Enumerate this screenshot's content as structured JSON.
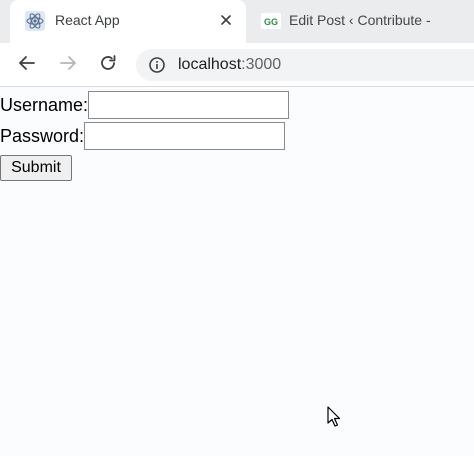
{
  "browser": {
    "tabs": [
      {
        "title": "React App",
        "favicon": "react-atom-icon",
        "active": true
      },
      {
        "title": "Edit Post ‹ Contribute -",
        "favicon": "gfg-logo-icon",
        "active": false
      }
    ],
    "url": {
      "host": "localhost",
      "port": ":3000"
    },
    "icons": {
      "back": "back-arrow-icon",
      "forward": "forward-arrow-icon",
      "reload": "reload-icon",
      "site_info": "info-icon",
      "close_tab": "close-icon"
    }
  },
  "form": {
    "username_label": "Username:",
    "username_value": "",
    "password_label": "Password:",
    "password_value": "",
    "submit_label": "Submit"
  },
  "colors": {
    "tabstrip_bg": "#ebecee",
    "active_tab_bg": "#ffffff",
    "page_bg": "#fbfcfe",
    "react_blue": "#61dafb",
    "gfg_green": "#2f8d46"
  }
}
